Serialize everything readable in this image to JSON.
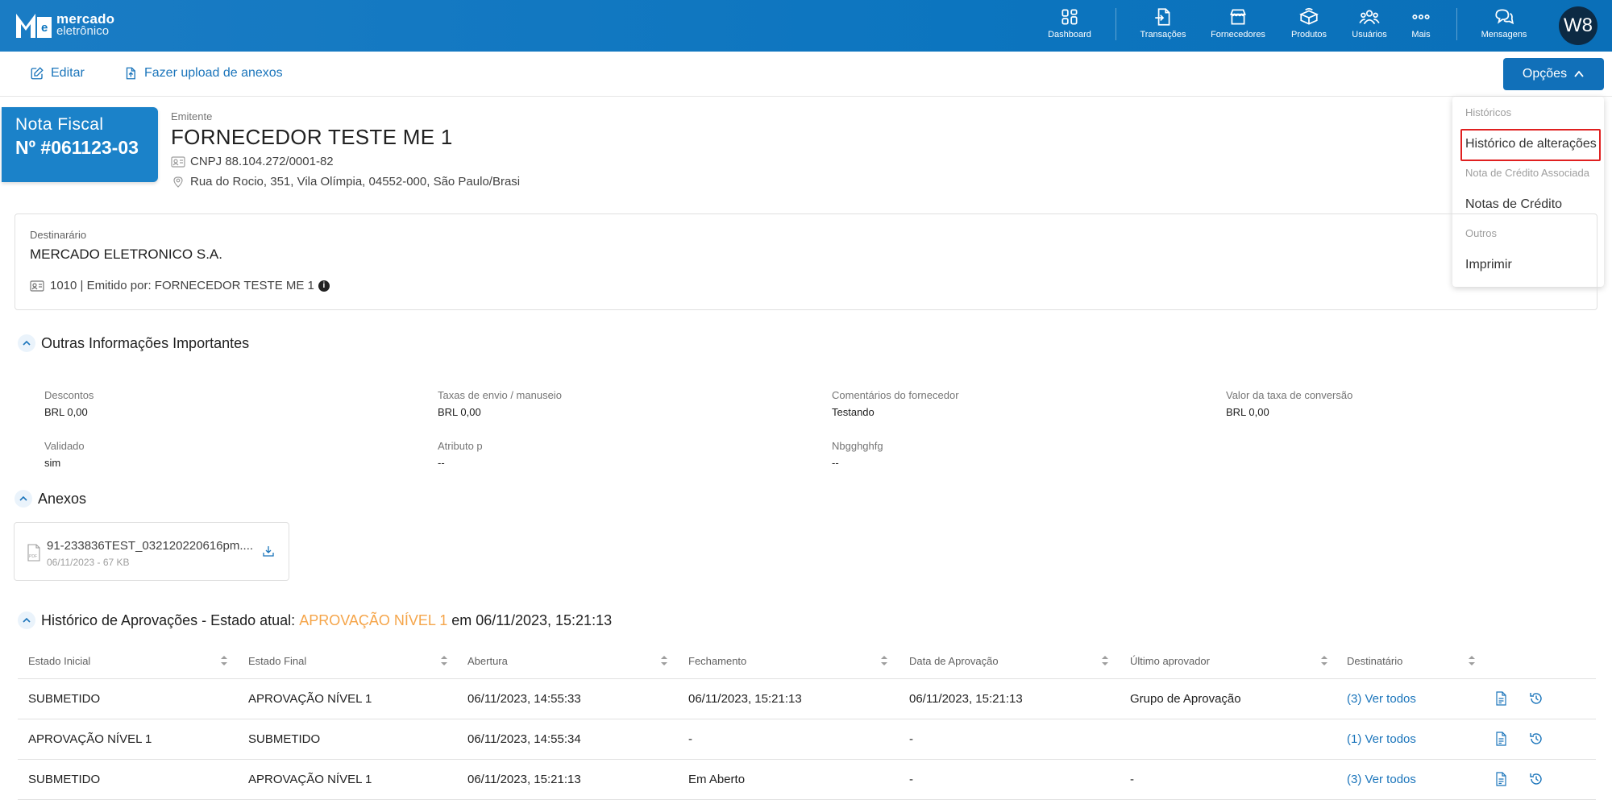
{
  "brand": {
    "line1": "mercado",
    "line2": "eletrônico",
    "color": "#0c75bf"
  },
  "nav": [
    {
      "label": "Dashboard",
      "icon": "dashboard-icon"
    },
    {
      "label": "Transações",
      "icon": "transactions-icon"
    },
    {
      "label": "Fornecedores",
      "icon": "suppliers-icon"
    },
    {
      "label": "Produtos",
      "icon": "products-icon"
    },
    {
      "label": "Usuários",
      "icon": "users-icon"
    },
    {
      "label": "Mais",
      "icon": "more-icon"
    },
    {
      "label": "Mensagens",
      "icon": "messages-icon"
    }
  ],
  "user": {
    "initials": "W8"
  },
  "toolbar": {
    "edit_label": "Editar",
    "upload_label": "Fazer upload de anexos",
    "options_label": "Opções"
  },
  "dropdown": {
    "header_historicos": "Históricos",
    "item_historico": "Histórico de alterações",
    "header_nota_credito": "Nota de Crédito Associada",
    "item_notas": "Notas de Crédito",
    "header_outros": "Outros",
    "item_imprimir": "Imprimir"
  },
  "invoice": {
    "title_line1": "Nota Fiscal",
    "title_line2": "Nº #061123-03"
  },
  "issuer": {
    "label": "Emitente",
    "name": "FORNECEDOR TESTE ME 1",
    "cnpj": "CNPJ 88.104.272/0001-82",
    "address": "Rua do Rocio, 351, Vila Olímpia, 04552-000, São Paulo/Brasi"
  },
  "recipient": {
    "label": "Destinarário",
    "name": "MERCADO ELETRONICO S.A.",
    "line": "1010 | Emitido por: FORNECEDOR TESTE ME 1"
  },
  "other_info": {
    "title": "Outras Informações Importantes",
    "fields": [
      {
        "key": "Descontos",
        "value": "BRL 0,00"
      },
      {
        "key": "Taxas de envio / manuseio",
        "value": "BRL 0,00"
      },
      {
        "key": "Comentários do fornecedor",
        "value": "Testando"
      },
      {
        "key": "Valor da taxa de conversão",
        "value": "BRL 0,00"
      },
      {
        "key": "Validado",
        "value": "sim"
      },
      {
        "key": "Atributo p",
        "value": "--"
      },
      {
        "key": "Nbgghghfg",
        "value": "--"
      }
    ]
  },
  "attachments": {
    "title": "Anexos",
    "file_name": "91-233836TEST_032120220616pm....",
    "file_meta": "06/11/2023 - 67 KB",
    "file_type": "PDF"
  },
  "approvals": {
    "title_prefix": "Histórico de Aprovações - Estado atual:",
    "state": "APROVAÇÃO NÍVEL 1",
    "title_suffix": "em 06/11/2023, 15:21:13",
    "state_color": "#f5a54a",
    "columns": [
      "Estado Inicial",
      "Estado Final",
      "Abertura",
      "Fechamento",
      "Data de Aprovação",
      "Último aprovador",
      "Destinatário"
    ],
    "rows": [
      [
        "SUBMETIDO",
        "APROVAÇÃO NÍVEL 1",
        "06/11/2023, 14:55:33",
        "06/11/2023, 15:21:13",
        "06/11/2023, 15:21:13",
        "Grupo de Aprovação",
        "(3) Ver todos"
      ],
      [
        "APROVAÇÃO NÍVEL 1",
        "SUBMETIDO",
        "06/11/2023, 14:55:34",
        "-",
        "-",
        "",
        "(1) Ver todos"
      ],
      [
        "SUBMETIDO",
        "APROVAÇÃO NÍVEL 1",
        "06/11/2023, 15:21:13",
        "Em Aberto",
        "-",
        "-",
        "(3) Ver todos"
      ]
    ]
  }
}
